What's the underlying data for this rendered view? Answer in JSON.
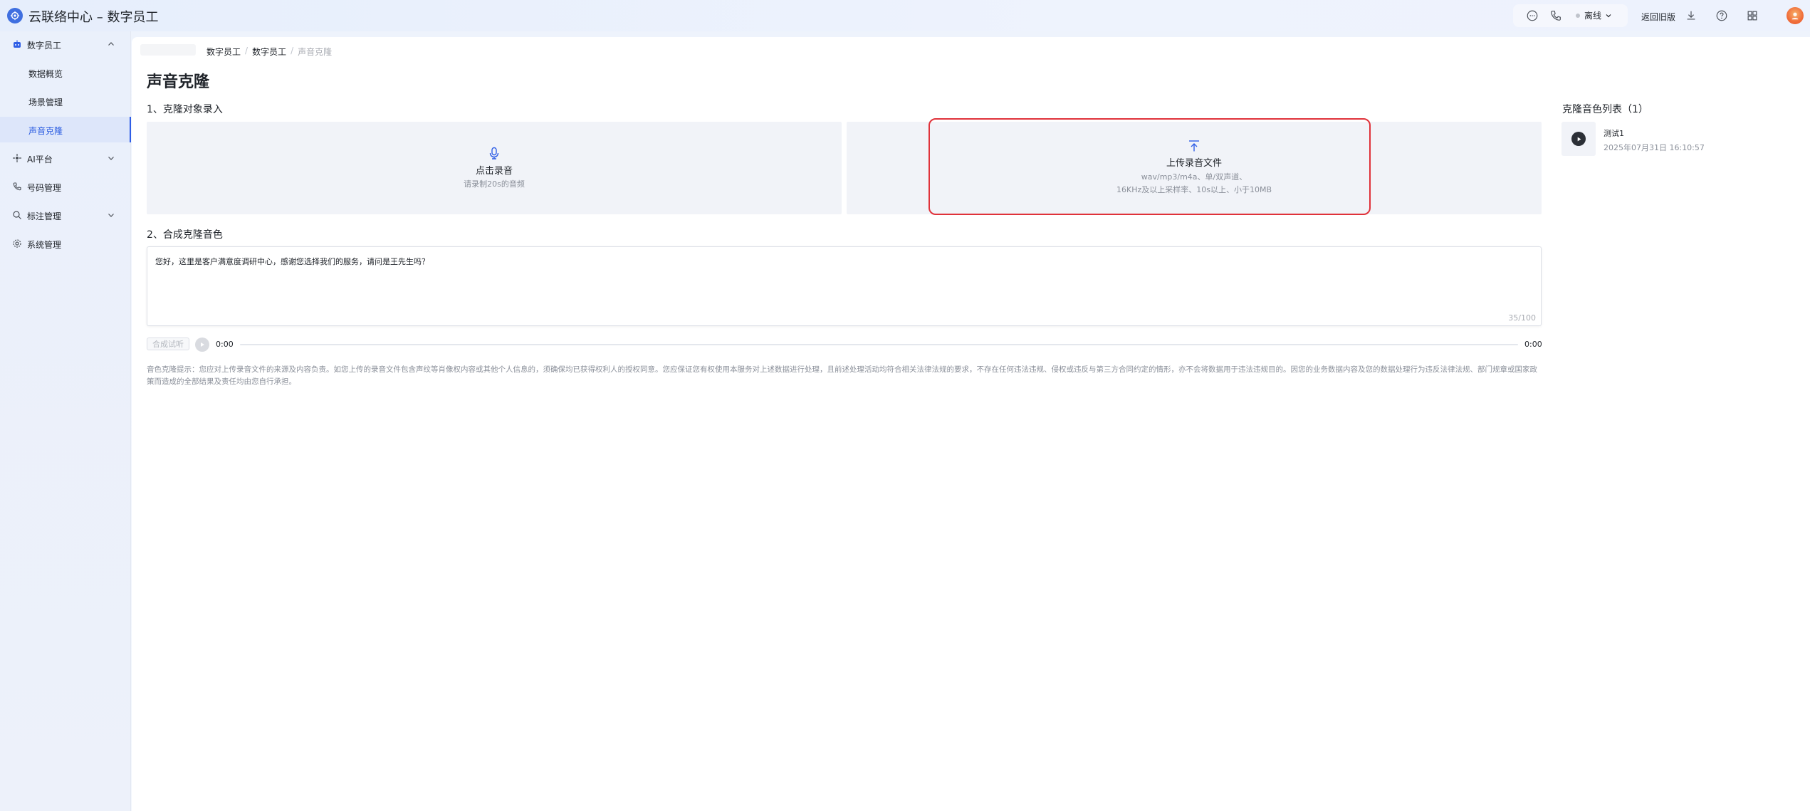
{
  "app": {
    "title": "云联络中心 – 数字员工"
  },
  "header": {
    "status_label": "离线",
    "old_version_label": "返回旧版",
    "icons": [
      "message-icon",
      "phone-icon",
      "download-icon",
      "help-icon",
      "apps-grid-icon"
    ]
  },
  "sidebar": {
    "groups": [
      {
        "label": "数字员工",
        "icon": "robot-icon",
        "expanded": true
      },
      {
        "label": "AI平台",
        "icon": "ai-icon",
        "expanded": false
      },
      {
        "label": "号码管理",
        "icon": "phone-icon"
      },
      {
        "label": "标注管理",
        "icon": "tag-icon",
        "expanded": false
      },
      {
        "label": "系统管理",
        "icon": "gear-icon"
      }
    ],
    "items": [
      {
        "label": "数据概览"
      },
      {
        "label": "场景管理"
      },
      {
        "label": "声音克隆",
        "active": true
      }
    ]
  },
  "breadcrumb": [
    "数字员工",
    "数字员工",
    "声音克隆"
  ],
  "page": {
    "title": "声音克隆"
  },
  "section1": {
    "title": "1、克隆对象录入",
    "record": {
      "title": "点击录音",
      "hint": "请录制20s的音频"
    },
    "upload": {
      "title": "上传录音文件",
      "hint_line1": "wav/mp3/m4a、单/双声道、",
      "hint_line2": "16KHz及以上采样率、10s以上、小于10MB"
    }
  },
  "section2": {
    "title": "2、合成克隆音色",
    "text": "您好，这里是客户满意度调研中心，感谢您选择我们的服务，请问是王先生吗？",
    "counter": "35/100",
    "synth_button": "合成试听",
    "time_current": "0:00",
    "time_total": "0:00",
    "progress": 0
  },
  "notice": "音色克隆提示：您应对上传录音文件的来源及内容负责。如您上传的录音文件包含声纹等肖像权内容或其他个人信息的，须确保均已获得权利人的授权同意。您应保证您有权使用本服务对上述数据进行处理，且前述处理活动均符合相关法律法规的要求，不存在任何违法违规、侵权或违反与第三方合同约定的情形，亦不会将数据用于违法违规目的。因您的业务数据内容及您的数据处理行为违反法律法规、部门规章或国家政策而造成的全部结果及责任均由您自行承担。",
  "voice_list": {
    "title": "克隆音色列表（1）",
    "items": [
      {
        "name": "测试1",
        "date": "2025年07月31日 16:10:57"
      }
    ]
  },
  "colors": {
    "accent": "#2f5ee6",
    "highlight": "#e0323a",
    "card_bg": "#f1f3f8"
  }
}
